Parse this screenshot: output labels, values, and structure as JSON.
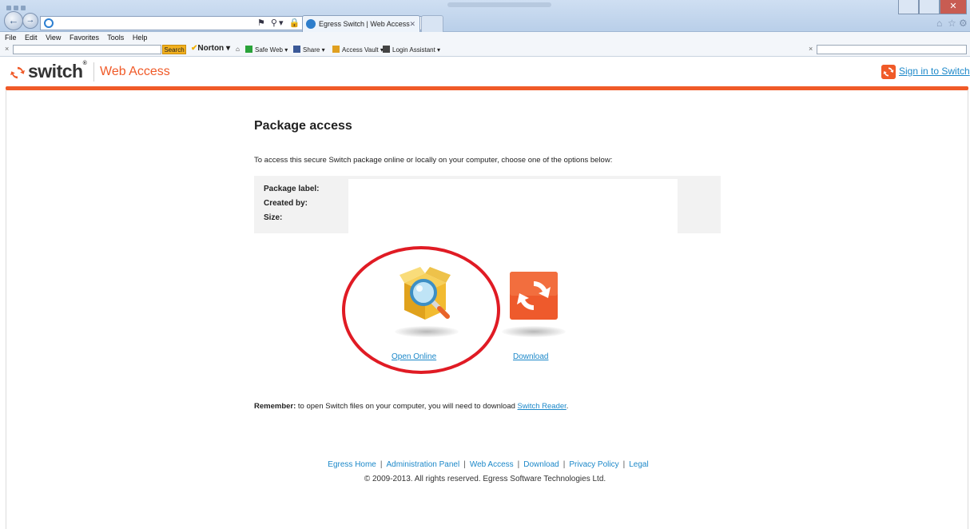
{
  "browser": {
    "tab_title": "Egress Switch | Web Access",
    "menu": [
      "File",
      "Edit",
      "View",
      "Favorites",
      "Tools",
      "Help"
    ],
    "toolbar": {
      "search_button": "Search",
      "norton": "Norton",
      "safe_web": "Safe Web",
      "share": "Share",
      "access_vault": "Access Vault",
      "login_assistant": "Login Assistant"
    }
  },
  "header": {
    "logo_text": "switch",
    "section": "Web Access",
    "sign_in": "Sign in to Switch"
  },
  "main": {
    "title": "Package access",
    "intro": "To access this secure Switch package online or locally on your computer, choose one of the options below:",
    "info_labels": [
      "Package label:",
      "Created by:",
      "Size:"
    ],
    "options": [
      {
        "label": "Open Online",
        "icon": "box-magnifier-icon"
      },
      {
        "label": "Download",
        "icon": "switch-download-icon"
      }
    ],
    "remember": {
      "bold": "Remember:",
      "text": " to open Switch files on your computer, you will need to download ",
      "link": "Switch Reader",
      "end": "."
    }
  },
  "footer": {
    "links": [
      "Egress Home",
      "Administration Panel",
      "Web Access",
      "Download",
      "Privacy Policy",
      "Legal"
    ],
    "copyright": "© 2009-2013. All rights reserved. Egress Software Technologies Ltd."
  },
  "colors": {
    "brand_orange": "#f05a28",
    "link_blue": "#1c88c9",
    "highlight_red": "#e01b24"
  }
}
